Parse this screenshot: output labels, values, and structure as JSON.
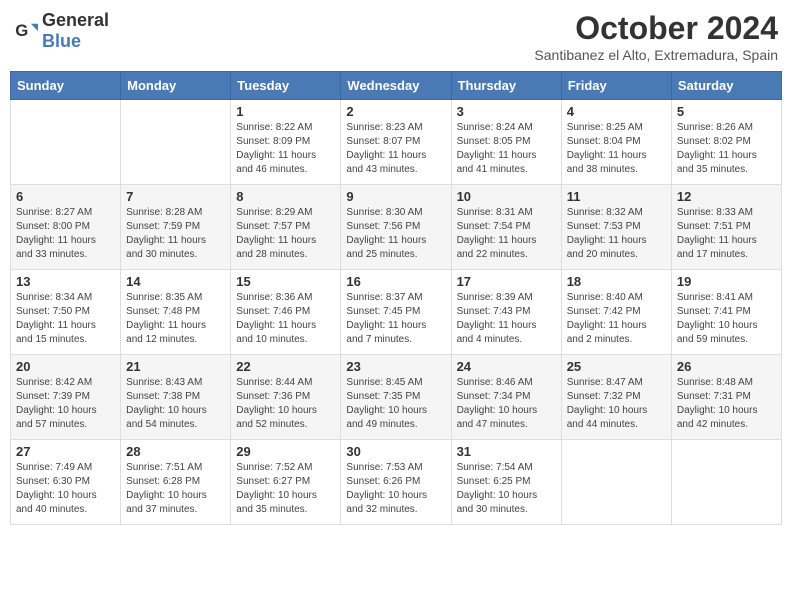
{
  "logo": {
    "general": "General",
    "blue": "Blue"
  },
  "title": "October 2024",
  "subtitle": "Santibanez el Alto, Extremadura, Spain",
  "days": [
    "Sunday",
    "Monday",
    "Tuesday",
    "Wednesday",
    "Thursday",
    "Friday",
    "Saturday"
  ],
  "weeks": [
    [
      {
        "day": "",
        "info": ""
      },
      {
        "day": "",
        "info": ""
      },
      {
        "day": "1",
        "info": "Sunrise: 8:22 AM\nSunset: 8:09 PM\nDaylight: 11 hours and 46 minutes."
      },
      {
        "day": "2",
        "info": "Sunrise: 8:23 AM\nSunset: 8:07 PM\nDaylight: 11 hours and 43 minutes."
      },
      {
        "day": "3",
        "info": "Sunrise: 8:24 AM\nSunset: 8:05 PM\nDaylight: 11 hours and 41 minutes."
      },
      {
        "day": "4",
        "info": "Sunrise: 8:25 AM\nSunset: 8:04 PM\nDaylight: 11 hours and 38 minutes."
      },
      {
        "day": "5",
        "info": "Sunrise: 8:26 AM\nSunset: 8:02 PM\nDaylight: 11 hours and 35 minutes."
      }
    ],
    [
      {
        "day": "6",
        "info": "Sunrise: 8:27 AM\nSunset: 8:00 PM\nDaylight: 11 hours and 33 minutes."
      },
      {
        "day": "7",
        "info": "Sunrise: 8:28 AM\nSunset: 7:59 PM\nDaylight: 11 hours and 30 minutes."
      },
      {
        "day": "8",
        "info": "Sunrise: 8:29 AM\nSunset: 7:57 PM\nDaylight: 11 hours and 28 minutes."
      },
      {
        "day": "9",
        "info": "Sunrise: 8:30 AM\nSunset: 7:56 PM\nDaylight: 11 hours and 25 minutes."
      },
      {
        "day": "10",
        "info": "Sunrise: 8:31 AM\nSunset: 7:54 PM\nDaylight: 11 hours and 22 minutes."
      },
      {
        "day": "11",
        "info": "Sunrise: 8:32 AM\nSunset: 7:53 PM\nDaylight: 11 hours and 20 minutes."
      },
      {
        "day": "12",
        "info": "Sunrise: 8:33 AM\nSunset: 7:51 PM\nDaylight: 11 hours and 17 minutes."
      }
    ],
    [
      {
        "day": "13",
        "info": "Sunrise: 8:34 AM\nSunset: 7:50 PM\nDaylight: 11 hours and 15 minutes."
      },
      {
        "day": "14",
        "info": "Sunrise: 8:35 AM\nSunset: 7:48 PM\nDaylight: 11 hours and 12 minutes."
      },
      {
        "day": "15",
        "info": "Sunrise: 8:36 AM\nSunset: 7:46 PM\nDaylight: 11 hours and 10 minutes."
      },
      {
        "day": "16",
        "info": "Sunrise: 8:37 AM\nSunset: 7:45 PM\nDaylight: 11 hours and 7 minutes."
      },
      {
        "day": "17",
        "info": "Sunrise: 8:39 AM\nSunset: 7:43 PM\nDaylight: 11 hours and 4 minutes."
      },
      {
        "day": "18",
        "info": "Sunrise: 8:40 AM\nSunset: 7:42 PM\nDaylight: 11 hours and 2 minutes."
      },
      {
        "day": "19",
        "info": "Sunrise: 8:41 AM\nSunset: 7:41 PM\nDaylight: 10 hours and 59 minutes."
      }
    ],
    [
      {
        "day": "20",
        "info": "Sunrise: 8:42 AM\nSunset: 7:39 PM\nDaylight: 10 hours and 57 minutes."
      },
      {
        "day": "21",
        "info": "Sunrise: 8:43 AM\nSunset: 7:38 PM\nDaylight: 10 hours and 54 minutes."
      },
      {
        "day": "22",
        "info": "Sunrise: 8:44 AM\nSunset: 7:36 PM\nDaylight: 10 hours and 52 minutes."
      },
      {
        "day": "23",
        "info": "Sunrise: 8:45 AM\nSunset: 7:35 PM\nDaylight: 10 hours and 49 minutes."
      },
      {
        "day": "24",
        "info": "Sunrise: 8:46 AM\nSunset: 7:34 PM\nDaylight: 10 hours and 47 minutes."
      },
      {
        "day": "25",
        "info": "Sunrise: 8:47 AM\nSunset: 7:32 PM\nDaylight: 10 hours and 44 minutes."
      },
      {
        "day": "26",
        "info": "Sunrise: 8:48 AM\nSunset: 7:31 PM\nDaylight: 10 hours and 42 minutes."
      }
    ],
    [
      {
        "day": "27",
        "info": "Sunrise: 7:49 AM\nSunset: 6:30 PM\nDaylight: 10 hours and 40 minutes."
      },
      {
        "day": "28",
        "info": "Sunrise: 7:51 AM\nSunset: 6:28 PM\nDaylight: 10 hours and 37 minutes."
      },
      {
        "day": "29",
        "info": "Sunrise: 7:52 AM\nSunset: 6:27 PM\nDaylight: 10 hours and 35 minutes."
      },
      {
        "day": "30",
        "info": "Sunrise: 7:53 AM\nSunset: 6:26 PM\nDaylight: 10 hours and 32 minutes."
      },
      {
        "day": "31",
        "info": "Sunrise: 7:54 AM\nSunset: 6:25 PM\nDaylight: 10 hours and 30 minutes."
      },
      {
        "day": "",
        "info": ""
      },
      {
        "day": "",
        "info": ""
      }
    ]
  ]
}
